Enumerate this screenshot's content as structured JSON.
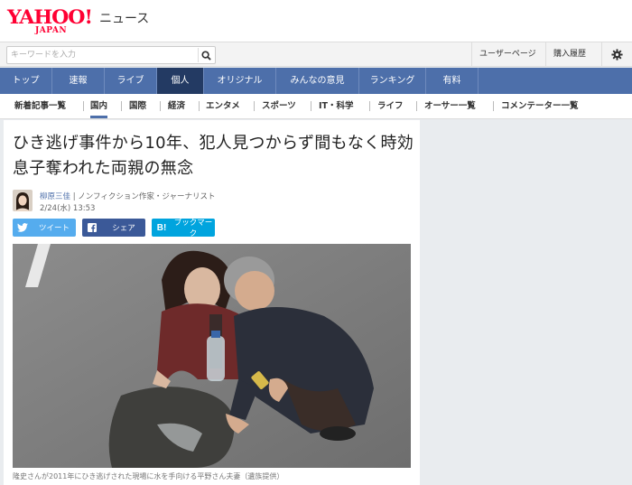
{
  "header": {
    "logo_main": "YAHOO!",
    "logo_sub": "JAPAN",
    "service": "ニュース"
  },
  "search": {
    "placeholder": "キーワードを入力",
    "button_icon": "search-icon",
    "links": [
      "ユーザーページ",
      "購入履歴"
    ],
    "settings_icon": "gear-icon"
  },
  "main_nav": {
    "items": [
      "トップ",
      "速報",
      "ライブ",
      "個人",
      "オリジナル",
      "みんなの意見",
      "ランキング",
      "有料"
    ],
    "active": "個人"
  },
  "sub_nav": {
    "items": [
      "新着記事一覧",
      "国内",
      "国際",
      "経済",
      "エンタメ",
      "スポーツ",
      "IT・科学",
      "ライフ",
      "オーサー一覧",
      "コメンテーター一覧"
    ],
    "active": "国内"
  },
  "article": {
    "title": "ひき逃げ事件から10年、犯人見つからず間もなく時効　息子奪われた両親の無念",
    "author_name": "柳原三佳",
    "author_role": "ノンフィクション作家・ジャーナリスト",
    "date": "2/24(水) 13:53",
    "share": {
      "tweet": "ツイート",
      "facebook": "シェア",
      "bookmark": "ブックマーク"
    },
    "caption": "隆史さんが2011年にひき逃げされた現場に水を手向ける平野さん夫妻（遺族提供）"
  },
  "colors": {
    "brand_red": "#ff0033",
    "nav_blue": "#4d6faa",
    "nav_active": "#233a63",
    "twitter": "#55acee",
    "facebook": "#3b5998",
    "hatena": "#00a4de"
  }
}
